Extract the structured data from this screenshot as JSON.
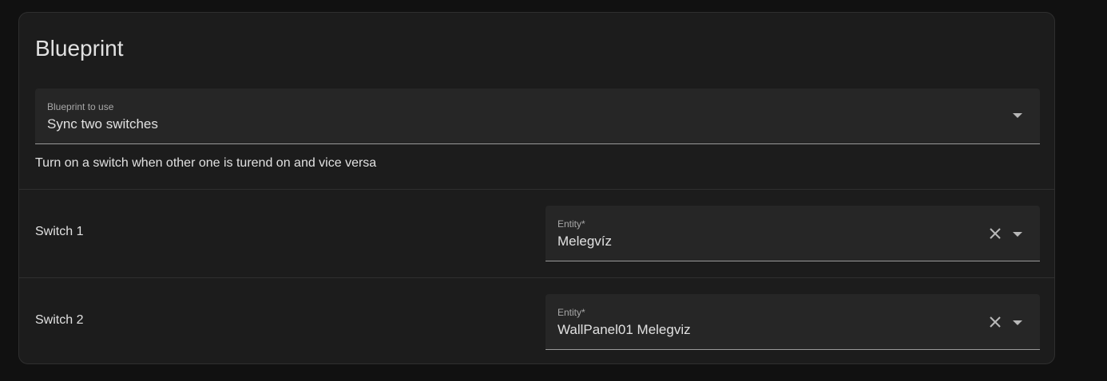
{
  "card": {
    "title": "Blueprint"
  },
  "blueprint_select": {
    "label": "Blueprint to use",
    "value": "Sync two switches"
  },
  "description": "Turn on a switch when other one is turend on and vice versa",
  "inputs": [
    {
      "name": "Switch 1",
      "field_label": "Entity*",
      "value": "Melegvíz"
    },
    {
      "name": "Switch 2",
      "field_label": "Entity*",
      "value": "WallPanel01 Melegviz"
    }
  ],
  "icons": {
    "dropdown": "chevron-down-icon",
    "clear": "close-icon"
  },
  "colors": {
    "background": "#111111",
    "card": "#1c1c1c",
    "field": "#262626",
    "text": "#e1e1e1",
    "label": "#a8a8a8"
  }
}
